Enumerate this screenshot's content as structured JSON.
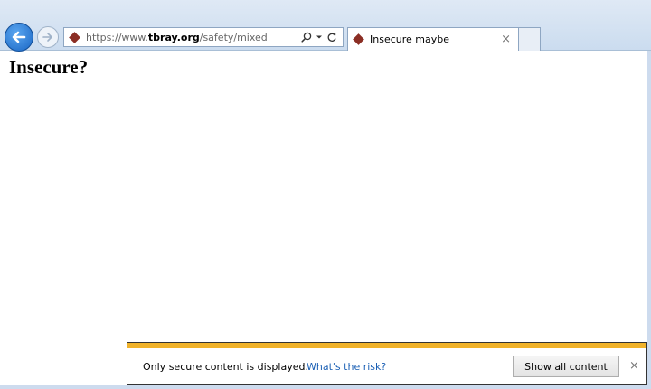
{
  "browser": {
    "back_icon": "back-arrow-icon",
    "forward_icon": "forward-arrow-icon",
    "address": {
      "prefix": "https://www.",
      "domain": "tbray.org",
      "path": "/safety/mixed",
      "search_icon": "search-icon",
      "dropdown_icon": "dropdown-icon",
      "refresh_icon": "refresh-icon"
    },
    "tab": {
      "title": "Insecure maybe",
      "close_glyph": "×"
    },
    "site_icon_color": "#8b2e24"
  },
  "page": {
    "heading": "Insecure?"
  },
  "notification": {
    "message": "Only secure content is displayed.",
    "link": "What's the risk?",
    "button": "Show all content",
    "close_glyph": "×",
    "accent_color": "#f0b22a"
  }
}
